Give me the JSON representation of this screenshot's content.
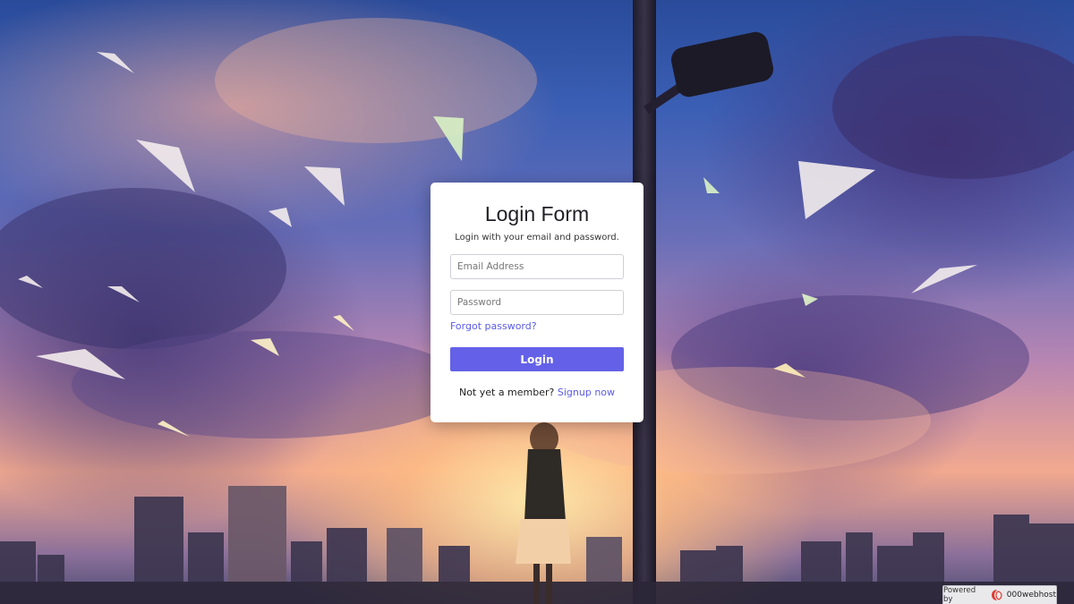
{
  "login_form": {
    "title": "Login Form",
    "subtitle": "Login with your email and password.",
    "email_placeholder": "Email Address",
    "password_placeholder": "Password",
    "forgot_password": "Forgot password?",
    "login_button": "Login",
    "not_member_text": "Not yet a member? ",
    "signup_link": "Signup now"
  },
  "footer_badge": {
    "powered_by": "Powered by",
    "brand": "000webhost",
    "brand_icon": "000webhost-logo-icon"
  },
  "colors": {
    "accent": "#6461e8",
    "link": "#5b5be6",
    "card_background": "#ffffff"
  }
}
